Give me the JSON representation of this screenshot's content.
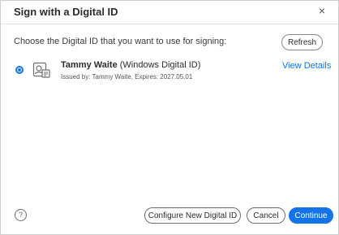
{
  "dialog": {
    "title": "Sign with a Digital ID",
    "close_symbol": "×"
  },
  "prompt": "Choose the Digital ID that you want to use for signing:",
  "refresh_label": "Refresh",
  "digital_id": {
    "name": "Tammy Waite",
    "type": " (Windows Digital ID)",
    "issued": "Issued by: Tammy Waite, Expires: 2027.05.01",
    "selected": true,
    "view_details_label": "View Details"
  },
  "footer": {
    "help_symbol": "?",
    "configure_label": "Configure New Digital ID",
    "cancel_label": "Cancel",
    "continue_label": "Continue"
  },
  "colors": {
    "accent": "#1473e6"
  }
}
